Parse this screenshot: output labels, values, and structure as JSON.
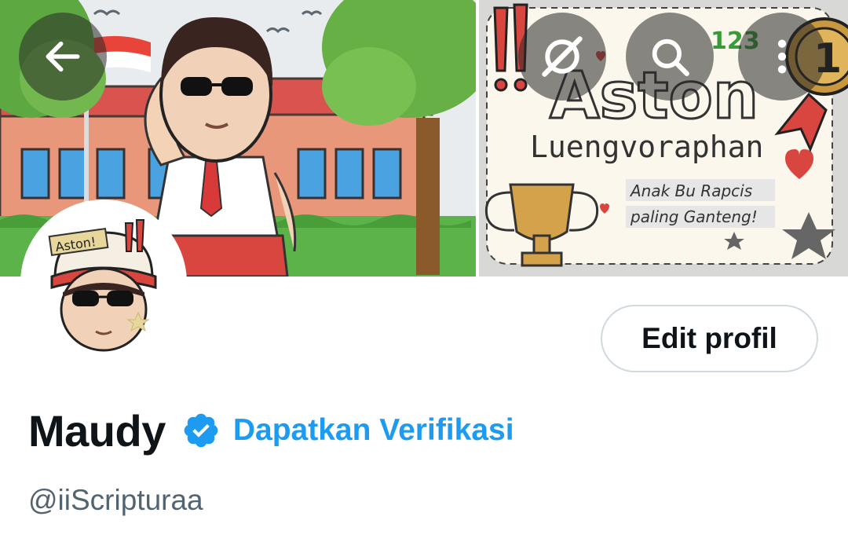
{
  "profile": {
    "display_name": "Maudy",
    "handle": "@iiScripturaa",
    "verify_link": "Dapatkan Verifikasi",
    "edit_button": "Edit profil"
  },
  "banner": {
    "left_label": "Aston!",
    "title_big": "Aston",
    "title_sub": "Luengvoraphan",
    "tag_line1": "Anak Bu Rapcis",
    "tag_line2": "paling Ganteng!",
    "numbers": "123",
    "medal": "1"
  },
  "avatar": {
    "hat_label": "Aston!"
  },
  "icons": {
    "back": "arrow-left-icon",
    "grok": "grok-icon",
    "search": "search-icon",
    "more": "more-vertical-icon",
    "verified": "verified-badge-icon"
  },
  "colors": {
    "accent": "#1d9bf0",
    "text_primary": "#0f1419",
    "text_secondary": "#536471",
    "border": "#cfd9de"
  }
}
